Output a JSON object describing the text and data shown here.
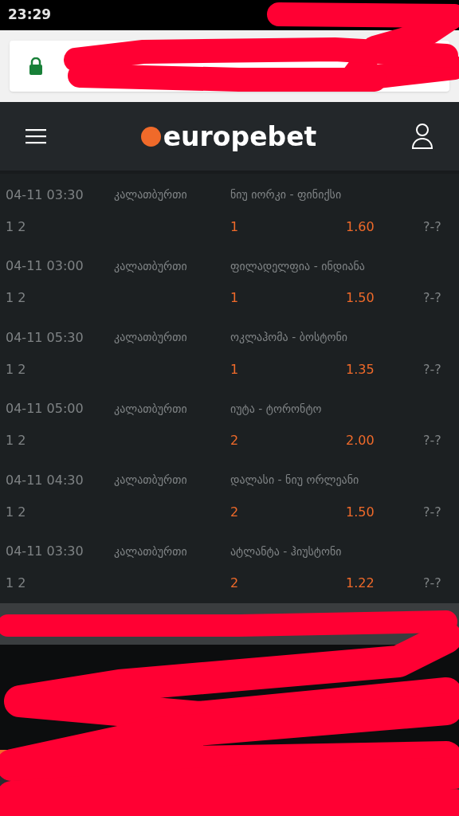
{
  "status_bar": {
    "time": "23:29"
  },
  "header": {
    "logo": "europebet"
  },
  "events": [
    {
      "date_time": "04-11 03:30",
      "sport": "კალათბურთი",
      "match": "ნიუ იორკი - ფინიქსი",
      "market": "1 2",
      "pick": "1",
      "odds": "1.60",
      "score": "?-?"
    },
    {
      "date_time": "04-11 03:00",
      "sport": "კალათბურთი",
      "match": "ფილადელფია - ინდიანა",
      "market": "1 2",
      "pick": "1",
      "odds": "1.50",
      "score": "?-?"
    },
    {
      "date_time": "04-11 05:30",
      "sport": "კალათბურთი",
      "match": "ოკლაჰომა - ბოსტონი",
      "market": "1 2",
      "pick": "1",
      "odds": "1.35",
      "score": "?-?"
    },
    {
      "date_time": "04-11 05:00",
      "sport": "კალათბურთი",
      "match": "იუტა - ტორონტო",
      "market": "1 2",
      "pick": "2",
      "odds": "2.00",
      "score": "?-?"
    },
    {
      "date_time": "04-11 04:30",
      "sport": "კალათბურთი",
      "match": "დალასი - ნიუ ორლეანი",
      "market": "1 2",
      "pick": "2",
      "odds": "1.50",
      "score": "?-?"
    },
    {
      "date_time": "04-11 03:30",
      "sport": "კალათბურთი",
      "match": "ატლანტა - ჰიუსტონი",
      "market": "1 2",
      "pick": "2",
      "odds": "1.22",
      "score": "?-?"
    }
  ]
}
